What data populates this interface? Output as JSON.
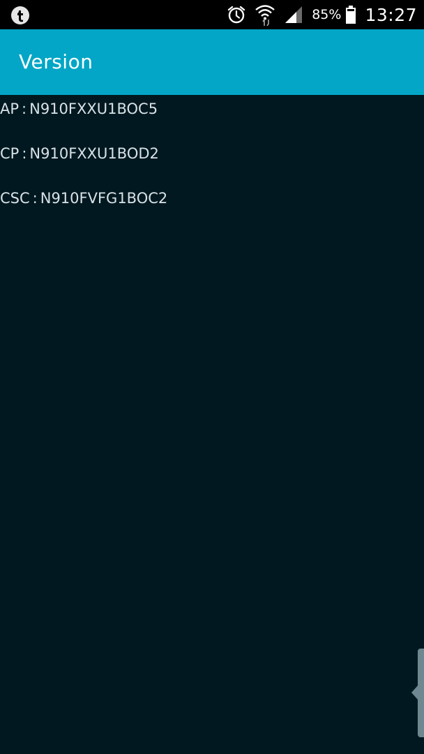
{
  "status_bar": {
    "left_icon": "tumblr-icon",
    "icons": [
      "alarm-icon",
      "wifi-icon",
      "signal-icon",
      "battery-icon"
    ],
    "battery_percent": "85%",
    "time": "13:27"
  },
  "app_bar": {
    "title": "Version",
    "color": "#03a6c6"
  },
  "versions": [
    {
      "label": "AP",
      "separator": ":",
      "value": "N910FXXU1BOC5"
    },
    {
      "label": "CP",
      "separator": ":",
      "value": "N910FXXU1BOD2"
    },
    {
      "label": "CSC",
      "separator": ":",
      "value": "N910FVFG1BOC2"
    }
  ],
  "colors": {
    "background": "#011820",
    "text": "#d8e2e6",
    "status_bar": "#000000"
  }
}
